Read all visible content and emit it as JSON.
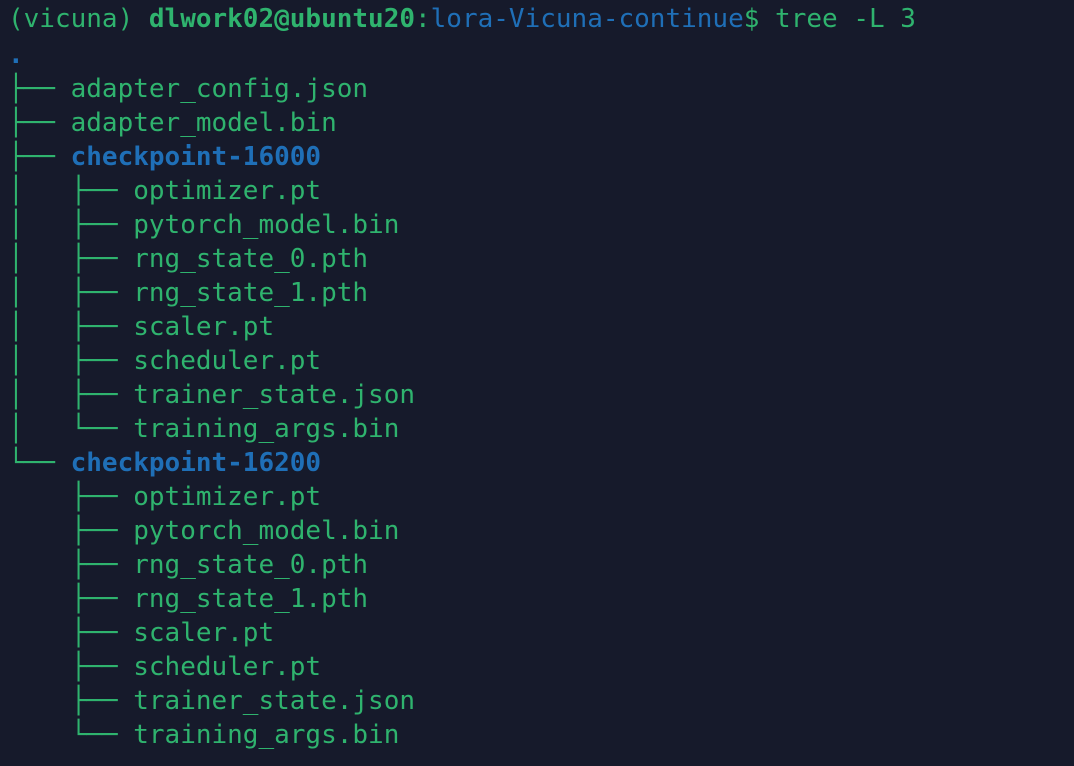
{
  "prompt": {
    "env": "(vicuna)",
    "user_host": "dlwork02@ubuntu20",
    "colon": ":",
    "cwd": "lora-Vicuna-continue",
    "symbol": "$",
    "command": "tree -L 3"
  },
  "tree": {
    "root": ".",
    "entries": [
      {
        "branch": "├── ",
        "name": "adapter_config.json",
        "type": "file"
      },
      {
        "branch": "├── ",
        "name": "adapter_model.bin",
        "type": "file"
      },
      {
        "branch": "├── ",
        "name": "checkpoint-16000",
        "type": "dir"
      },
      {
        "branch": "│   ├── ",
        "name": "optimizer.pt",
        "type": "file"
      },
      {
        "branch": "│   ├── ",
        "name": "pytorch_model.bin",
        "type": "file"
      },
      {
        "branch": "│   ├── ",
        "name": "rng_state_0.pth",
        "type": "file"
      },
      {
        "branch": "│   ├── ",
        "name": "rng_state_1.pth",
        "type": "file"
      },
      {
        "branch": "│   ├── ",
        "name": "scaler.pt",
        "type": "file"
      },
      {
        "branch": "│   ├── ",
        "name": "scheduler.pt",
        "type": "file"
      },
      {
        "branch": "│   ├── ",
        "name": "trainer_state.json",
        "type": "file"
      },
      {
        "branch": "│   └── ",
        "name": "training_args.bin",
        "type": "file"
      },
      {
        "branch": "└── ",
        "name": "checkpoint-16200",
        "type": "dir"
      },
      {
        "branch": "    ├── ",
        "name": "optimizer.pt",
        "type": "file"
      },
      {
        "branch": "    ├── ",
        "name": "pytorch_model.bin",
        "type": "file"
      },
      {
        "branch": "    ├── ",
        "name": "rng_state_0.pth",
        "type": "file"
      },
      {
        "branch": "    ├── ",
        "name": "rng_state_1.pth",
        "type": "file"
      },
      {
        "branch": "    ├── ",
        "name": "scaler.pt",
        "type": "file"
      },
      {
        "branch": "    ├── ",
        "name": "scheduler.pt",
        "type": "file"
      },
      {
        "branch": "    ├── ",
        "name": "trainer_state.json",
        "type": "file"
      },
      {
        "branch": "    └── ",
        "name": "training_args.bin",
        "type": "file"
      }
    ]
  },
  "colors": {
    "background": "#161a2b",
    "text_green": "#2fb36e",
    "dir_blue": "#1f6fb7"
  }
}
